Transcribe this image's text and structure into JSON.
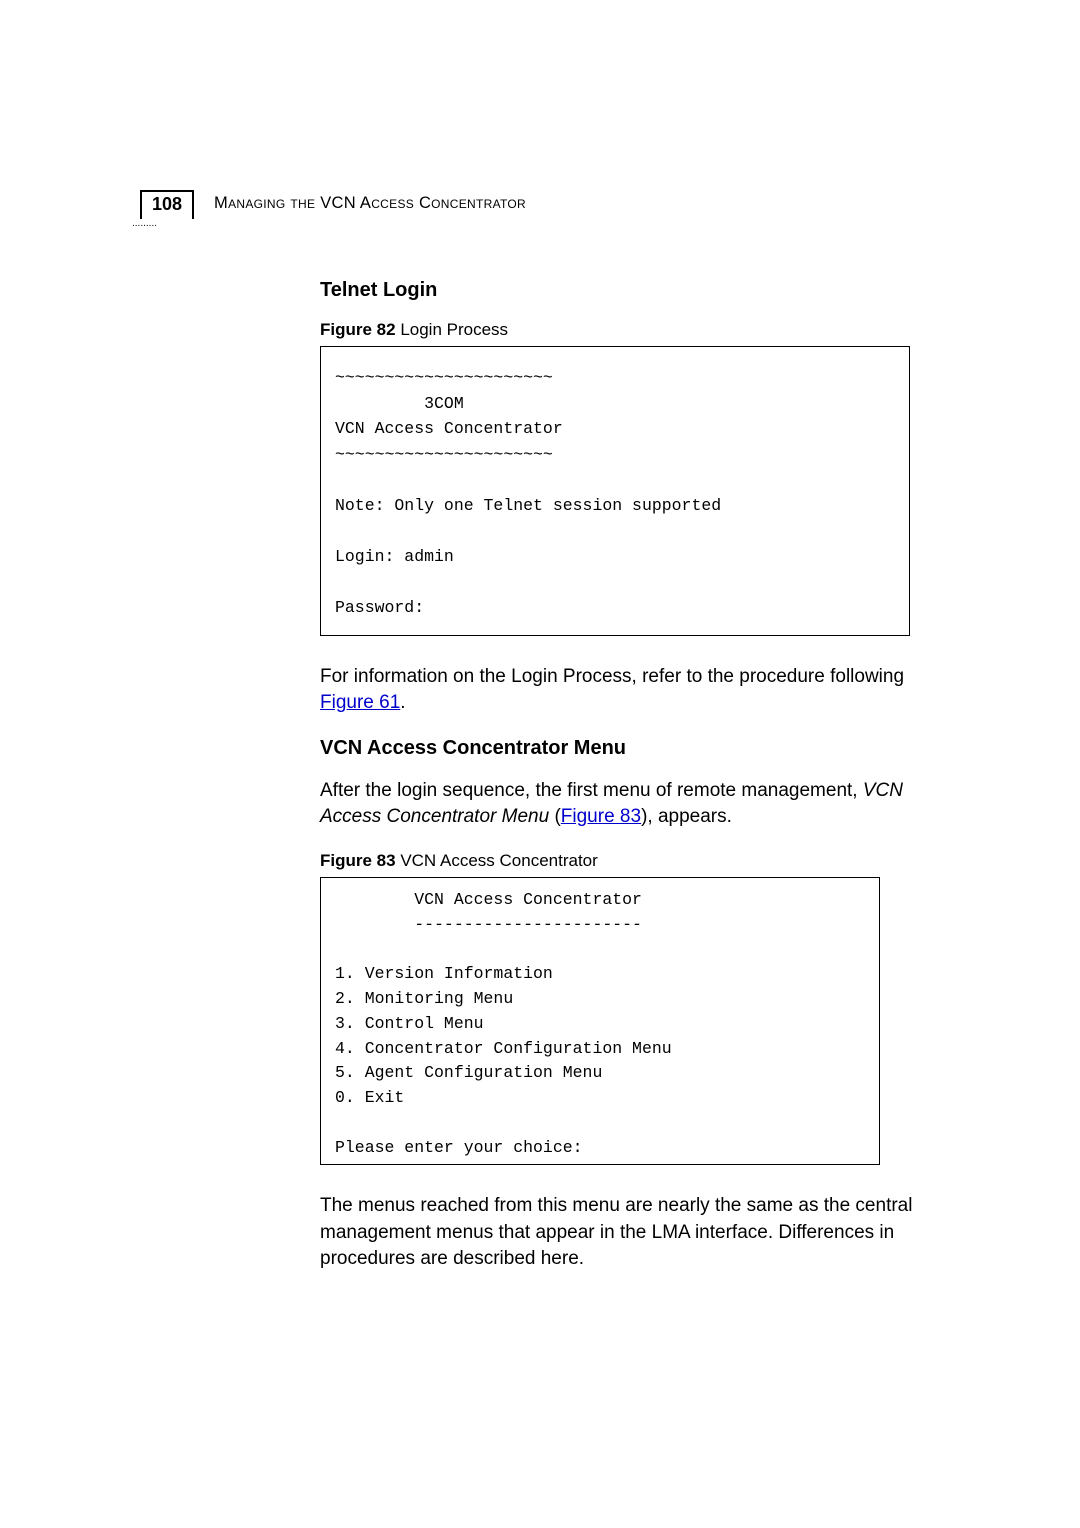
{
  "header": {
    "page_number": "108",
    "running_title": "Managing the VCN Access Concentrator",
    "dots": "........."
  },
  "sections": {
    "telnet": {
      "heading": "Telnet Login",
      "figure_label_bold": "Figure 82",
      "figure_label_rest": "   Login Process",
      "code": "~~~~~~~~~~~~~~~~~~~~~~\n         3COM\nVCN Access Concentrator\n~~~~~~~~~~~~~~~~~~~~~~\n\nNote: Only one Telnet session supported\n\nLogin: admin\n\nPassword:",
      "para_before_link": "For information on the Login Process, refer to the procedure following ",
      "link": "Figure 61",
      "para_after_link": "."
    },
    "vcn_menu": {
      "heading": "VCN Access Concentrator Menu",
      "para1_a": "After the login sequence, the first menu of remote management, ",
      "para1_italic": "VCN Access Concentrator Menu",
      "para1_b": " (",
      "para1_link": "Figure 83",
      "para1_c": "), appears.",
      "figure_label_bold": "Figure 83",
      "figure_label_rest": "   VCN Access Concentrator",
      "code": "        VCN Access Concentrator\n        -----------------------\n\n1. Version Information\n2. Monitoring Menu\n3. Control Menu\n4. Concentrator Configuration Menu\n5. Agent Configuration Menu\n0. Exit\n\nPlease enter your choice:",
      "para2": "The menus reached from this menu are nearly the same as the central management menus that appear in the LMA interface. Differences in procedures are described here."
    }
  }
}
